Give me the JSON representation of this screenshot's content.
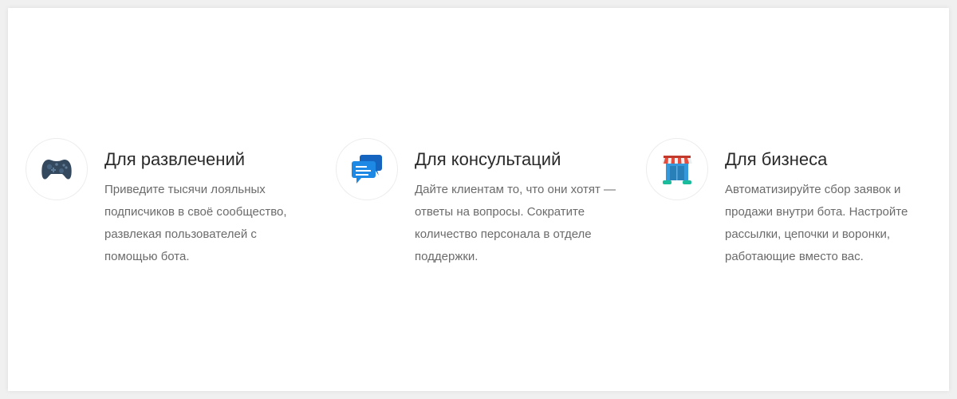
{
  "features": [
    {
      "icon": "gamepad-icon",
      "title": "Для развлечений",
      "description": "Приведите тысячи лояльных подписчиков в своё сообщество, развлекая пользователей с помощью бота."
    },
    {
      "icon": "chat-bubbles-icon",
      "title": "Для консультаций",
      "description": "Дайте клиентам то, что они хотят — ответы на вопросы. Сократите количество персонала в отделе поддержки."
    },
    {
      "icon": "store-icon",
      "title": "Для бизнеса",
      "description": "Автоматизируйте сбор заявок и продажи внутри бота. Настройте рассылки, цепочки и воронки, работающие вместо вас."
    }
  ],
  "colors": {
    "gamepad": "#34495e",
    "chat_primary": "#1e88e5",
    "chat_secondary": "#1565c0",
    "store_awning": "#e74c3c",
    "store_body": "#3498db",
    "store_base": "#1abc9c"
  }
}
